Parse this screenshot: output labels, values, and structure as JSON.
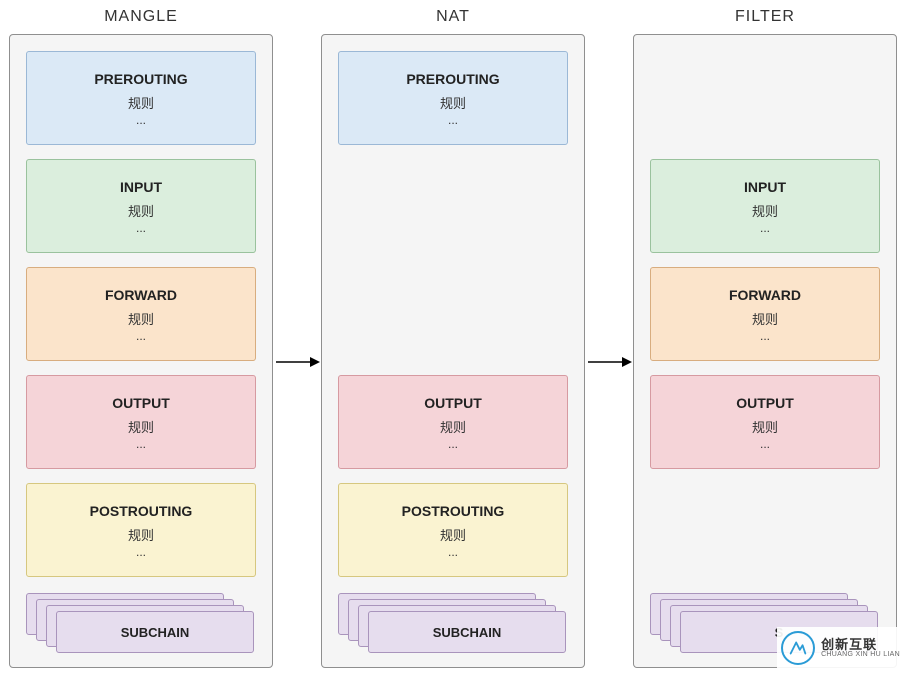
{
  "labels": {
    "rule": "规则",
    "dots": "...",
    "subchain": "SUBCHAIN",
    "subchain_s": "S"
  },
  "tables": {
    "mangle": {
      "title": "MANGLE",
      "prerouting": "PREROUTING",
      "input": "INPUT",
      "forward": "FORWARD",
      "output": "OUTPUT",
      "postrouting": "POSTROUTING"
    },
    "nat": {
      "title": "NAT",
      "prerouting": "PREROUTING",
      "output": "OUTPUT",
      "postrouting": "POSTROUTING"
    },
    "filter": {
      "title": "FILTER",
      "input": "INPUT",
      "forward": "FORWARD",
      "output": "OUTPUT"
    }
  },
  "watermark": {
    "cn": "创新互联",
    "py": "CHUANG XIN HU LIAN"
  }
}
